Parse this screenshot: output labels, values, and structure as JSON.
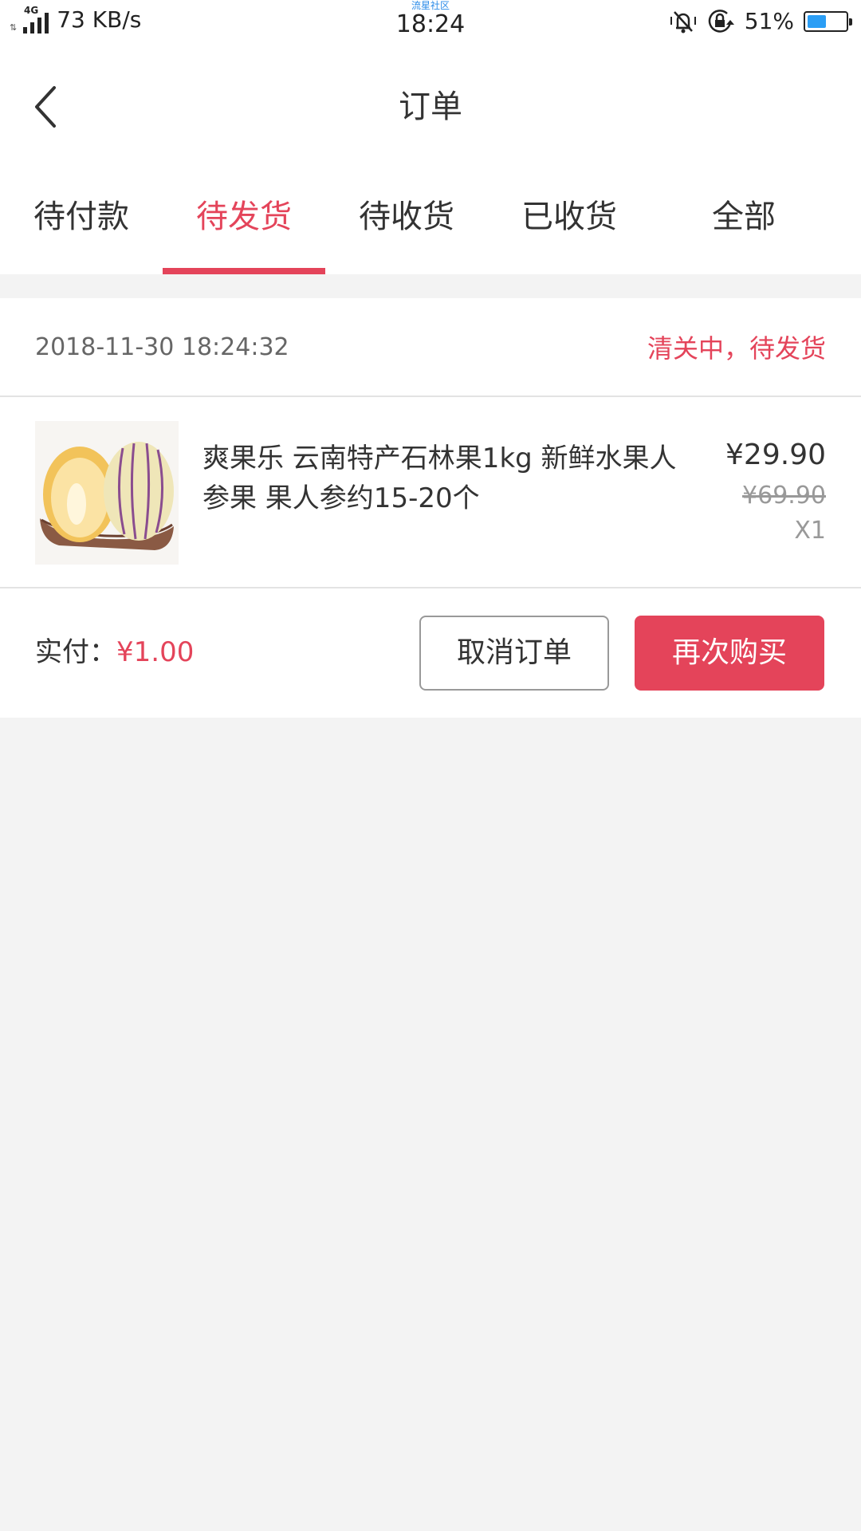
{
  "status_bar": {
    "network": "4G",
    "speed": "73 KB/s",
    "community": "流星社区",
    "time": "18:24",
    "battery_percent": "51%",
    "battery_level": 0.51,
    "battery_color": "#2b9ef5"
  },
  "header": {
    "title": "订单",
    "back_icon": "chevron-left-icon"
  },
  "tabs": [
    {
      "label": "待付款",
      "active": false
    },
    {
      "label": "待发货",
      "active": true
    },
    {
      "label": "待收货",
      "active": false
    },
    {
      "label": "已收货",
      "active": false
    },
    {
      "label": "全部",
      "active": false
    }
  ],
  "order": {
    "datetime": "2018-11-30 18:24:32",
    "status": "清关中，待发货",
    "item": {
      "name": "爽果乐 云南特产石林果1kg 新鲜水果人参果 果人参约15-20个",
      "price": "¥29.90",
      "original_price": "¥69.90",
      "quantity": "X1"
    },
    "paid_label": "实付：",
    "paid_amount": "¥1.00",
    "cancel_label": "取消订单",
    "rebuy_label": "再次购买"
  },
  "colors": {
    "accent": "#e4445a",
    "background": "#f3f3f3"
  }
}
